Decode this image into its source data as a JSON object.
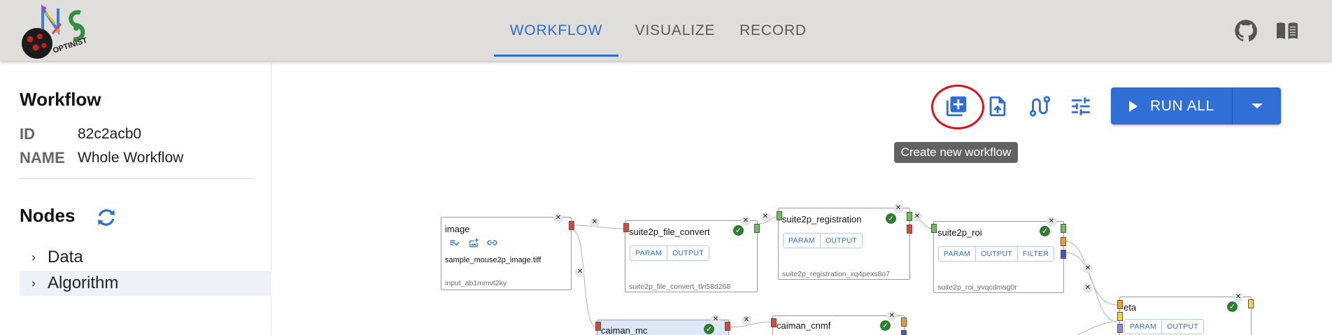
{
  "header": {
    "logo_text": "OPTINIST",
    "tabs": [
      {
        "label": "WORKFLOW",
        "active": true
      },
      {
        "label": "VISUALIZE",
        "active": false
      },
      {
        "label": "RECORD",
        "active": false
      }
    ],
    "icons": [
      "github-icon",
      "book-icon"
    ]
  },
  "sidebar": {
    "workflow_title": "Workflow",
    "id_label": "ID",
    "id_value": "82c2acb0",
    "name_label": "NAME",
    "name_value": "Whole Workflow",
    "nodes_title": "Nodes",
    "tree": [
      {
        "label": "Data",
        "selected": false
      },
      {
        "label": "Algorithm",
        "selected": true
      }
    ]
  },
  "toolbar": {
    "icons": [
      "create-workflow-icon",
      "import-icon",
      "route-icon",
      "settings-tune-icon"
    ],
    "run_all_label": "RUN ALL",
    "tooltip": "Create new workflow"
  },
  "nodes": [
    {
      "title": "image",
      "file": "sample_mouse2p_image.tiff",
      "id": "input_ab1mmvt2ky"
    },
    {
      "title": "suite2p_file_convert",
      "buttons": [
        "PARAM",
        "OUTPUT"
      ],
      "id": "suite2p_file_convert_tlri58d268"
    },
    {
      "title": "suite2p_registration",
      "buttons": [
        "PARAM",
        "OUTPUT"
      ],
      "id": "suite2p_registration_xq4pexs8o7"
    },
    {
      "title": "suite2p_roi",
      "buttons": [
        "PARAM",
        "OUTPUT",
        "FILTER"
      ],
      "id": "suite2p_roi_yvqcdmsg0r"
    },
    {
      "title": "eta",
      "buttons": [
        "PARAM",
        "OUTPUT"
      ]
    },
    {
      "title": "caiman_mc"
    },
    {
      "title": "caiman_cnmf"
    }
  ],
  "colors": {
    "accent": "#2d6ed0",
    "header_bg": "#e0deda",
    "run_button": "#2f6fd6",
    "highlight_ring": "#e0101a",
    "success": "#2f7d32"
  }
}
